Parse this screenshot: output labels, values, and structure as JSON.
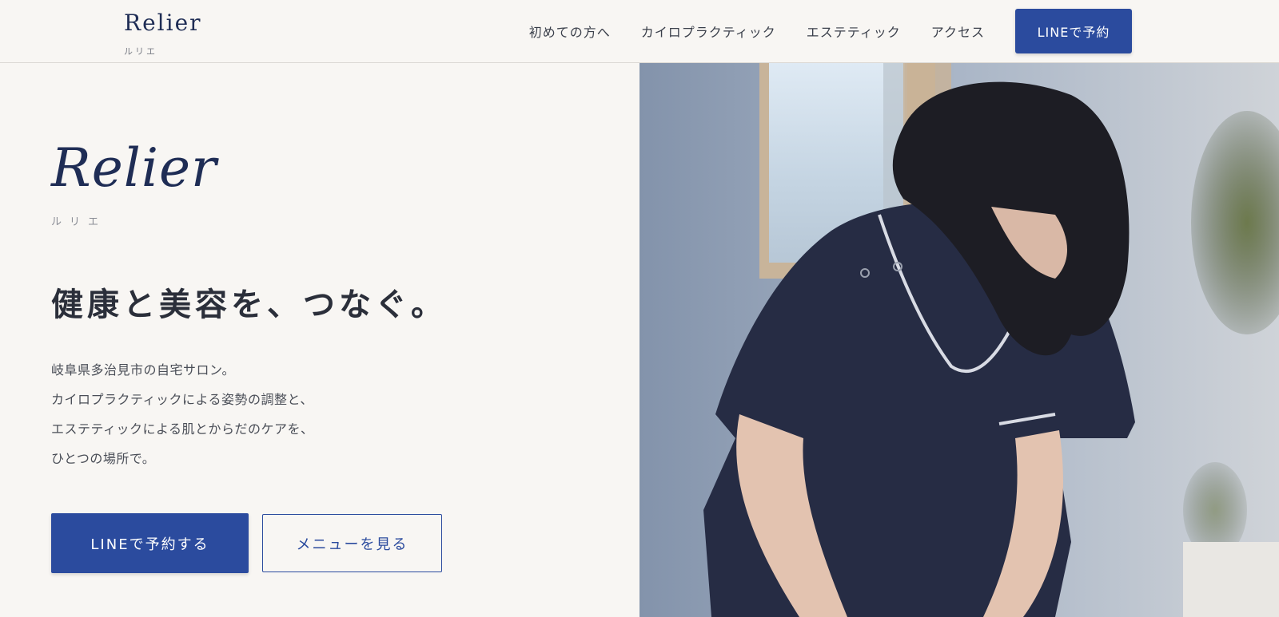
{
  "header": {
    "logo": "Relier",
    "logo_sub": "ルリエ",
    "nav": [
      "初めての方へ",
      "カイロプラクティック",
      "エステティック",
      "アクセス"
    ],
    "cta": "LINEで予約"
  },
  "hero": {
    "brand": "Relier",
    "brand_sub": "ルリエ",
    "tagline": "健康と美容を、つなぐ。",
    "body": [
      "岐阜県多治見市の自宅サロン。",
      "カイロプラクティックによる姿勢の調整と、",
      "エステティックによる肌とからだのケアを、",
      "ひとつの場所で。"
    ],
    "primary_button": "LINEで予約する",
    "secondary_button": "メニューを見る"
  },
  "colors": {
    "accent": "#2b4b9e",
    "brand_text": "#1f2d55",
    "background": "#f8f6f3"
  }
}
